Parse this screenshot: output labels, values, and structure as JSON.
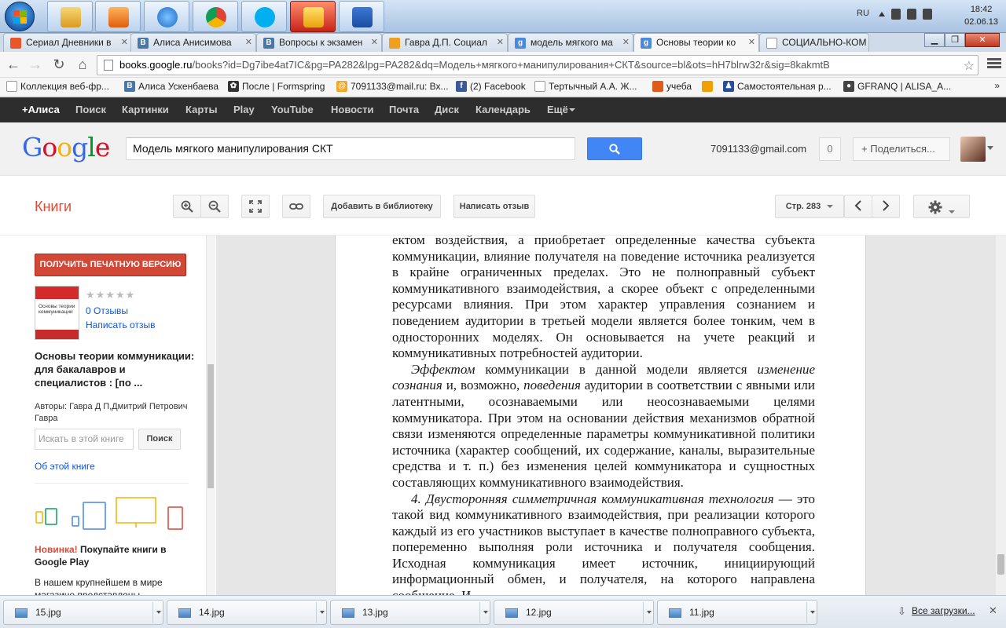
{
  "taskbar": {
    "apps": [
      "explorer",
      "media-player",
      "internet-explorer",
      "chrome",
      "skype",
      "games",
      "word"
    ],
    "lang": "RU",
    "time": "18:42",
    "date": "02.06.13"
  },
  "tabs": [
    {
      "label": "Сериал Дневники в",
      "icon": "fire-icon",
      "color": "#e8562a"
    },
    {
      "label": "Алиса Анисимова",
      "icon": "vk-icon",
      "color": "#4a76a8"
    },
    {
      "label": "Вопросы к экзамен",
      "icon": "vk-icon",
      "color": "#4a76a8"
    },
    {
      "label": "Гавра Д.П. Социал",
      "icon": "bookmark-icon",
      "color": "#f0a020"
    },
    {
      "label": "модель мягкого ма",
      "icon": "google-icon",
      "color": "#4a89dc"
    },
    {
      "label": "Основы теории ко",
      "icon": "google-icon",
      "color": "#4a89dc"
    },
    {
      "label": "СОЦИАЛЬНО-КОМ",
      "icon": "page-icon",
      "color": "#ffffff"
    }
  ],
  "omnibox": {
    "domain": "books.google.ru",
    "path": "/books?id=Dg7ibe4at7IC&pg=PA282&lpg=PA282&dq=Модель+мягкого+манипулирования+СКТ&source=bl&ots=hH7blrw32r&sig=8kakmtB"
  },
  "bookmarks": [
    {
      "label": "Коллекция веб-фр...",
      "icon": "web-slice-icon",
      "color": "#ffffff"
    },
    {
      "label": "Алиса Ускенбаева",
      "icon": "vk-icon",
      "color": "#4a76a8"
    },
    {
      "label": "После | Formspring",
      "icon": "formspring-icon",
      "color": "#333333"
    },
    {
      "label": "7091133@mail.ru: Вх...",
      "icon": "mail-icon",
      "color": "#f5a623"
    },
    {
      "label": "(2) Facebook",
      "icon": "facebook-icon",
      "color": "#3b5998"
    },
    {
      "label": "Тертычный А.А. Ж...",
      "icon": "page-icon",
      "color": "#ffffff"
    },
    {
      "label": "учеба",
      "icon": "folder-icon",
      "color": "#e05a1a"
    },
    {
      "label": "",
      "icon": "misc-icon",
      "color": "#f0a000"
    },
    {
      "label": "Самостоятельная р...",
      "icon": "user-icon",
      "color": "#2a4d9b"
    },
    {
      "label": "GFRANQ | ALISA_A...",
      "icon": "camera-icon",
      "color": "#444444"
    }
  ],
  "gbar": [
    "+Алиса",
    "Поиск",
    "Картинки",
    "Карты",
    "Play",
    "YouTube",
    "Новости",
    "Почта",
    "Диск",
    "Календарь",
    "Ещё"
  ],
  "header": {
    "logo": "Google",
    "query": "Модель мягкого манипулирования СКТ",
    "email": "7091133@gmail.com",
    "notifications": "0",
    "share": "Поделиться..."
  },
  "books": {
    "title": "Книги",
    "add_library": "Добавить в библиотеку",
    "write_review": "Написать отзыв",
    "page": "Стр. 283"
  },
  "sidebar": {
    "buy": "ПОЛУЧИТЬ ПЕЧАТНУЮ ВЕРСИЮ",
    "cover_title": "Основы теории коммуникации",
    "stars": "★★★★★",
    "reviews": "0 Отзывы",
    "write_review": "Написать отзыв",
    "book_title": "Основы теории коммуникации: для бакалавров и специалистов : [по ...",
    "authors": "Авторы: Гавра Д П,Дмитрий Петрович Гавра",
    "search_placeholder": "Искать в этой книге",
    "search_button": "Поиск",
    "about": "Об этой книге",
    "promo_new": "Новинка!",
    "promo_text": " Покупайте книги в Google Play",
    "promo2": "В нашем крупнейшем в мире магазине представлены"
  },
  "page_text": {
    "p1": "ектом воздействия, а приобретает определенные качества субъекта коммуникации, влияние получателя на поведение источника реализуется в крайне ограниченных пределах. Это не полноправный субъект коммуникативного взаимодействия, а скорее объект с определенными ресурсами влияния. При этом характер управления сознанием и поведением аудитории в третьей модели является более тонким, чем в односторонних моделях. Он основывается на учете реакций и коммуникативных потребностей аудитории.",
    "p2_em1": "Эффектом",
    "p2_a": " коммуникации в данной модели является ",
    "p2_em2": "изменение сознания",
    "p2_b": " и, возможно, ",
    "p2_em3": "поведения",
    "p2_c": " аудитории в соответствии с явными или латентными, осознаваемыми или неосознаваемыми целями коммуникатора. При этом на основании действия механизмов обратной связи изменяются определенные параметры коммуникативной политики источника (характер сообщений, их содержание, каналы, выразительные средства и т. п.) без изменения целей коммуникатора и сущностных составляющих коммуникативного взаимодействия.",
    "p3_em": "4. Двусторонняя симметричная коммуникативная технология",
    "p3": " — это такой вид коммуникативного взаимодействия, при реализации которого каждый из его участников выступает в качестве полноправного субъекта, попеременно выполняя роли источника и получателя сообщения. Исходная коммуникация имеет источник, инициирующий информационный обмен, и получателя, на которого направлена сообщение. И"
  },
  "downloads": {
    "files": [
      "15.jpg",
      "14.jpg",
      "13.jpg",
      "12.jpg",
      "11.jpg"
    ],
    "all": "Все загрузки..."
  }
}
